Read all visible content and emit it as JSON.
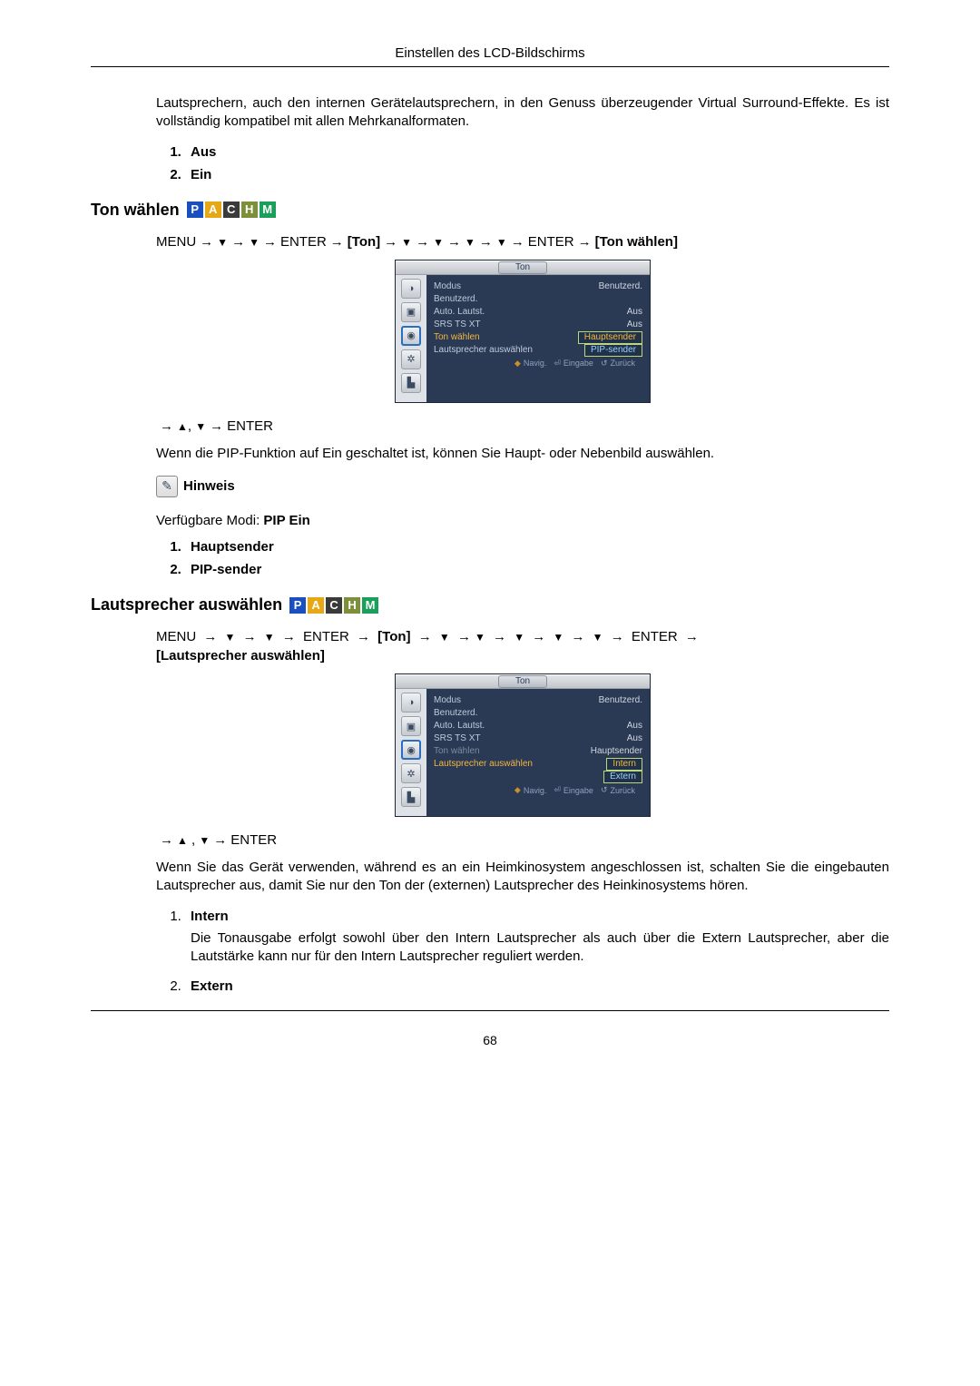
{
  "header": {
    "title": "Einstellen des LCD-Bildschirms"
  },
  "intro_para": "Lautsprechern, auch den internen Gerätelautsprechern, in den Genuss überzeugender Virtual Surround-Effekte. Es ist vollständig kompatibel mit allen Mehrkanalformaten.",
  "intro_list": {
    "i1": "Aus",
    "i2": "Ein"
  },
  "badges": {
    "p": "P",
    "a": "A",
    "c": "C",
    "h": "H",
    "m": "M"
  },
  "sec1": {
    "heading": "Ton wählen",
    "path_menu": "MENU",
    "path_enter": "ENTER",
    "path_ton": "[Ton]",
    "path_target": "[Ton wählen]",
    "after_osd": ", ",
    "after_osd_enter": "ENTER",
    "para": "Wenn die PIP-Funktion auf Ein geschaltet ist, können Sie Haupt- oder Nebenbild auswählen.",
    "note": "Hinweis",
    "modes_prefix": "Verfügbare Modi: ",
    "modes_value": "PIP Ein",
    "list": {
      "i1": "Hauptsender",
      "i2": "PIP-sender"
    }
  },
  "sec2": {
    "heading": "Lautsprecher auswählen",
    "path_menu": "MENU",
    "path_enter": "ENTER",
    "path_ton": "[Ton]",
    "path_target": "[Lautsprecher auswählen]",
    "after_osd_enter": "ENTER",
    "para": "Wenn Sie das Gerät verwenden, während es an ein Heimkinosystem angeschlossen ist, schalten Sie die eingebauten Lautsprecher aus, damit Sie nur den Ton der (externen) Lautsprecher des Heinkinosystems hören.",
    "list": {
      "i1": "Intern",
      "i1_desc": "Die Tonausgabe erfolgt sowohl über den Intern Lautsprecher als auch über die Extern Lautsprecher, aber die Lautstärke kann nur für den Intern Lautsprecher reguliert werden.",
      "i2": "Extern"
    }
  },
  "osd1": {
    "title": "Ton",
    "rows": {
      "modus_l": "Modus",
      "modus_v": "Benutzerd.",
      "benutzerd_l": "Benutzerd.",
      "autolautst_l": "Auto. Lautst.",
      "autolautst_v": "Aus",
      "srs_l": "SRS TS XT",
      "srs_v": "Aus",
      "tonwahlen_l": "Ton wählen",
      "tonwahlen_v": "Hauptsender",
      "laut_l": "Lautsprecher auswählen",
      "laut_v": "PIP-sender"
    },
    "footer": {
      "nav": "Navig.",
      "enter": "Eingabe",
      "back": "Zurück"
    }
  },
  "osd2": {
    "title": "Ton",
    "rows": {
      "modus_l": "Modus",
      "modus_v": "Benutzerd.",
      "benutzerd_l": "Benutzerd.",
      "autolautst_l": "Auto. Lautst.",
      "autolautst_v": "Aus",
      "srs_l": "SRS TS XT",
      "srs_v": "Aus",
      "tonwahlen_l": "Ton wählen",
      "tonwahlen_v": "Hauptsender",
      "laut_l": "Lautsprecher auswählen",
      "opt1": "Intern",
      "opt2": "Extern"
    },
    "footer": {
      "nav": "Navig.",
      "enter": "Eingabe",
      "back": "Zurück"
    }
  },
  "page_number": "68"
}
